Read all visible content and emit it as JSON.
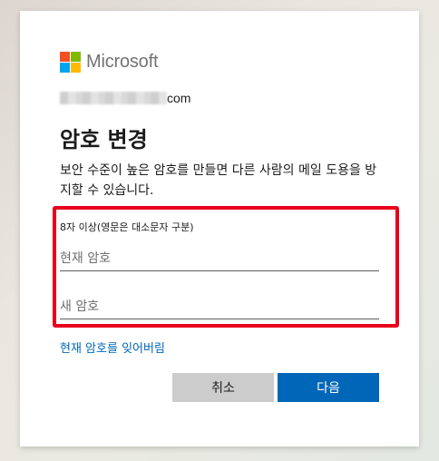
{
  "brand": {
    "name": "Microsoft",
    "colors": [
      "#f25022",
      "#7fba00",
      "#00a4ef",
      "#ffb900"
    ]
  },
  "account": {
    "suffix": "com"
  },
  "page": {
    "title": "암호 변경",
    "description": "보안 수준이 높은 암호를 만들면 다른 사람의 메일 도용을 방지할 수 있습니다."
  },
  "form": {
    "hint": "8자 이상(영문은 대소문자 구분)",
    "current_password_placeholder": "현재 암호",
    "new_password_placeholder": "새 암호",
    "forgot_link": "현재 암호를 잊어버림"
  },
  "buttons": {
    "cancel": "취소",
    "next": "다음"
  },
  "accent": {
    "primary": "#0067b8",
    "highlight": "#e8001c"
  }
}
